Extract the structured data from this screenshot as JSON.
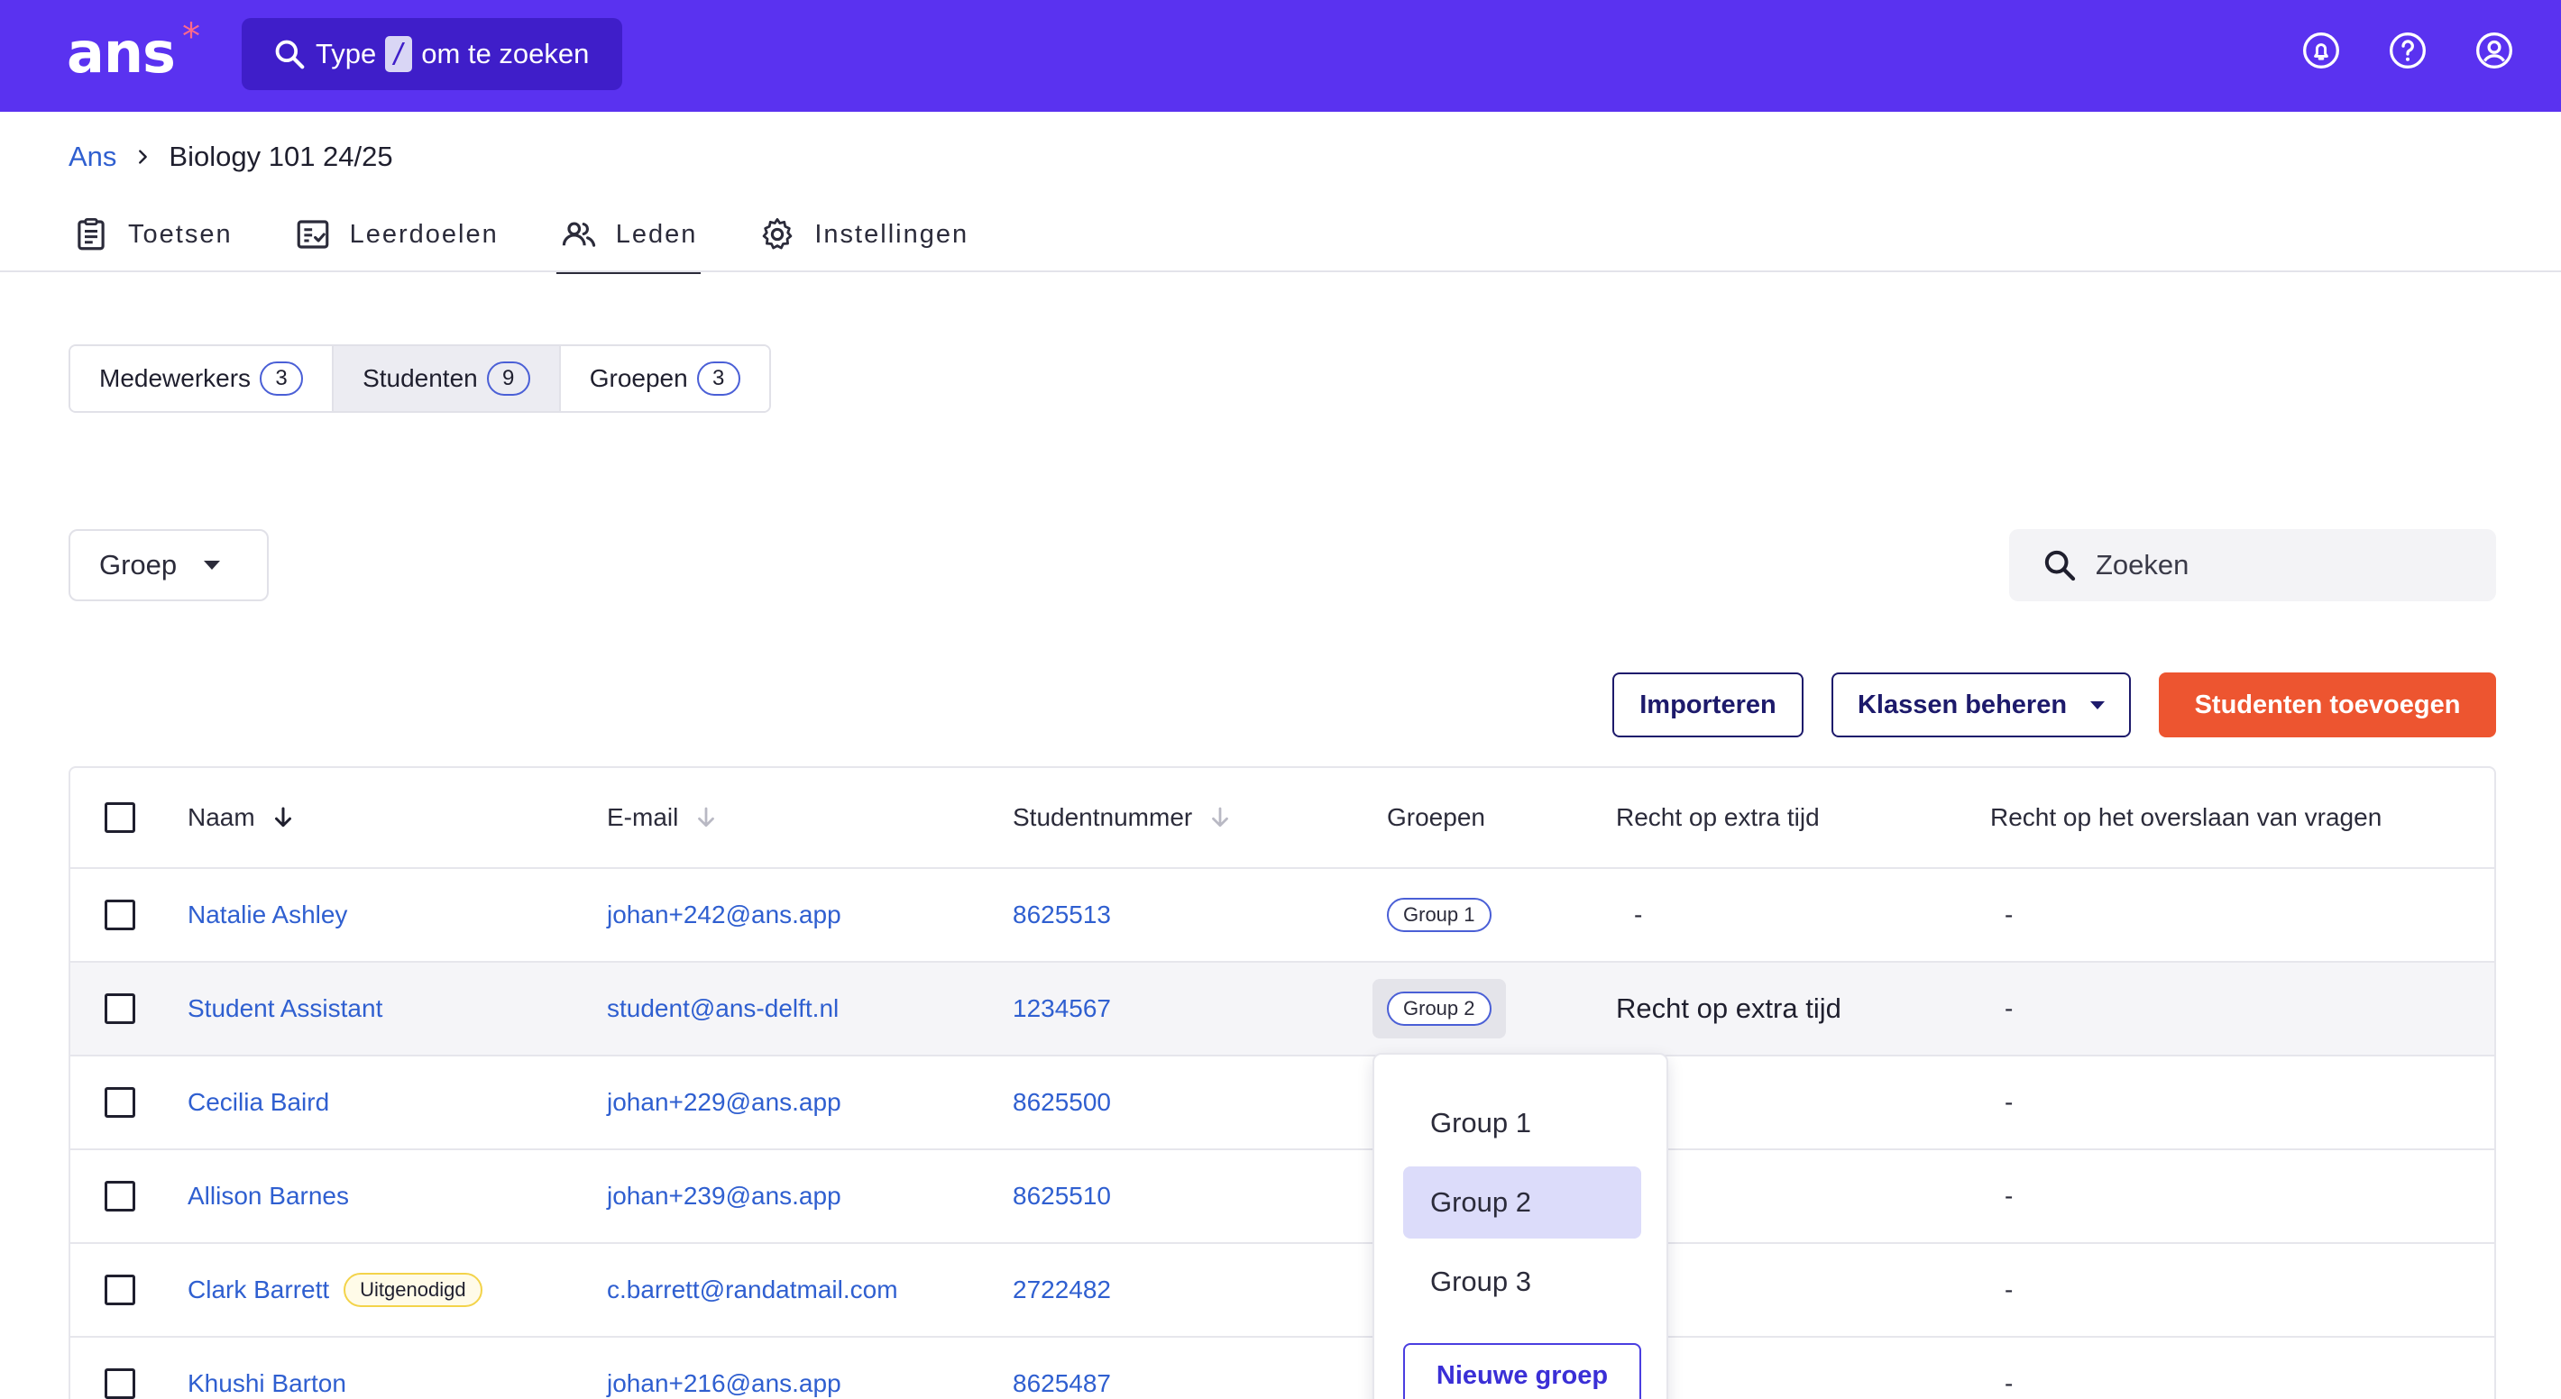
{
  "header": {
    "logo": "ans",
    "logo_mark": "*",
    "search_prefix": "Type",
    "search_key": "/",
    "search_suffix": "om te zoeken",
    "icons": [
      "bell-icon",
      "help-icon",
      "user-icon"
    ]
  },
  "breadcrumb": {
    "root": "Ans",
    "current": "Biology 101 24/25"
  },
  "main_tabs": [
    {
      "label": "Toetsen",
      "icon": "clipboard-icon"
    },
    {
      "label": "Leerdoelen",
      "icon": "checklist-icon"
    },
    {
      "label": "Leden",
      "icon": "people-icon",
      "active": true
    },
    {
      "label": "Instellingen",
      "icon": "gear-icon"
    }
  ],
  "segments": [
    {
      "label": "Medewerkers",
      "count": "3"
    },
    {
      "label": "Studenten",
      "count": "9",
      "active": true
    },
    {
      "label": "Groepen",
      "count": "3"
    }
  ],
  "filters": {
    "group_label": "Groep",
    "search_placeholder": "Zoeken"
  },
  "actions": {
    "import": "Importeren",
    "manage_classes": "Klassen beheren",
    "add_students": "Studenten toevoegen"
  },
  "table": {
    "columns": [
      "Naam",
      "E-mail",
      "Studentnummer",
      "Groepen",
      "Recht op extra tijd",
      "Recht op het overslaan van vragen"
    ],
    "rows": [
      {
        "name": "Natalie Ashley",
        "email": "johan+242@ans.app",
        "number": "8625513",
        "group": "Group 1",
        "extra_time": "-",
        "skip": "-"
      },
      {
        "name": "Student Assistant",
        "email": "student@ans-delft.nl",
        "number": "1234567",
        "group": "Group 2",
        "extra_time": "Recht op extra tijd",
        "skip": "-"
      },
      {
        "name": "Cecilia Baird",
        "email": "johan+229@ans.app",
        "number": "8625500",
        "group": "",
        "extra_time": "",
        "skip": "-"
      },
      {
        "name": "Allison Barnes",
        "email": "johan+239@ans.app",
        "number": "8625510",
        "group": "",
        "extra_time": "",
        "skip": "-"
      },
      {
        "name": "Clark Barrett",
        "badge": "Uitgenodigd",
        "email": "c.barrett@randatmail.com",
        "number": "2722482",
        "group": "",
        "extra_time": "",
        "skip": "-"
      },
      {
        "name": "Khushi Barton",
        "email": "johan+216@ans.app",
        "number": "8625487",
        "group": "",
        "extra_time": "",
        "skip": "-"
      }
    ]
  },
  "group_dropdown": {
    "options": [
      "Group 1",
      "Group 2",
      "Group 3"
    ],
    "selected": "Group 2",
    "new_group": "Nieuwe groep"
  },
  "colors": {
    "brand": "#5a32f0",
    "accent": "#ed5530",
    "link": "#2f5fd0"
  }
}
